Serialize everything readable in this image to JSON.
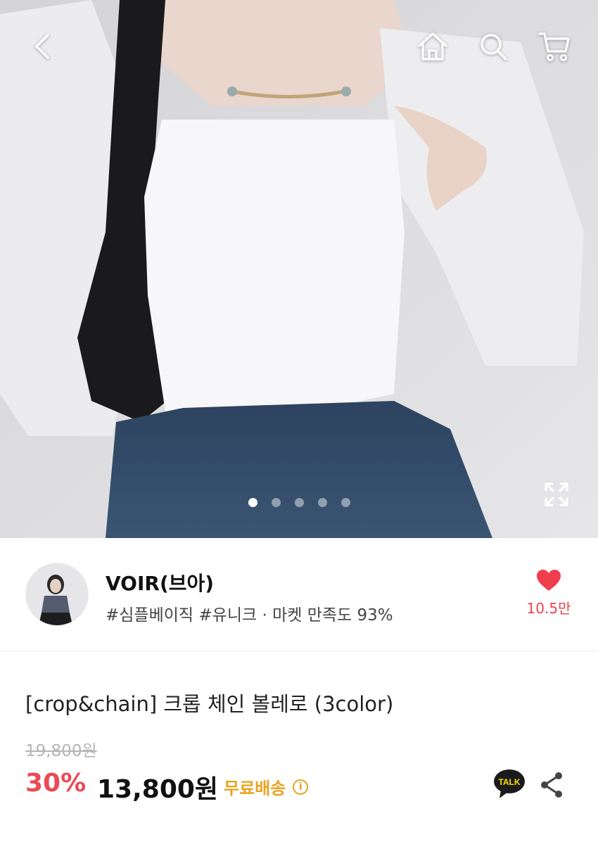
{
  "seller": {
    "name": "VOIR(브아)",
    "tags": "#심플베이직 #유니크 · 마켓 만족도 93%",
    "likes": "10.5만"
  },
  "product": {
    "title": "[crop&chain] 크롭 체인 볼레로 (3color)",
    "original_price": "19,800원",
    "discount": "30%",
    "price": "13,800원",
    "shipping": "무료배송",
    "info_glyph": "i",
    "talk_label": "TALK"
  },
  "gallery": {
    "total_images": 5,
    "current_index": 1
  },
  "icons": [
    "back-icon",
    "home-icon",
    "search-icon",
    "cart-icon",
    "expand-icon",
    "heart-icon",
    "info-icon",
    "kakao-talk-icon",
    "share-icon"
  ],
  "colors": {
    "discount": "#ea4b55",
    "like": "#e8434f",
    "shipping": "#e8a31e",
    "kakao": "#f9e000"
  }
}
